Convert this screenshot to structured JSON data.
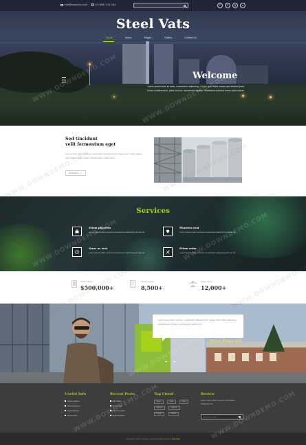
{
  "colors": {
    "accent": "#a8d11c",
    "footer_bg": "#3d3d3d",
    "name_yellow": "#ffe25a"
  },
  "topbar": {
    "email": "info@example.com",
    "phone": "+1 (800) 111 444",
    "search_placeholder": "",
    "social": [
      {
        "icon": "facebook-icon",
        "glyph": "f"
      },
      {
        "icon": "twitter-icon",
        "glyph": "t"
      },
      {
        "icon": "google-plus-icon",
        "glyph": "g"
      },
      {
        "icon": "linkedin-icon",
        "glyph": "in"
      }
    ]
  },
  "header": {
    "logo": "Steel Vats",
    "nav": [
      "Home",
      "About",
      "Pages",
      "Gallery",
      "Contact Us"
    ],
    "active_nav": "Home"
  },
  "hero": {
    "title": "Welcome",
    "text_1": "Lorem ipsum dolor sit amet, consectetur adipiscing. ",
    "highlight": "Integer",
    "text_2": " quis mollis massa quis eleifend justo. Donec condimentum, porta risus et, consectetur laoreet. Vestibulum euismod lectus varius ipsum."
  },
  "about": {
    "title_line1": "Sed tincidunt",
    "title_line2": "velit fermentum eget",
    "text": "Lorem ipsum dolor sit amet, consectetur adipiscing elit. Integer quis mollis massa quis eleifend justo. Donec condimentum mattis risus.",
    "read_more": "Read More"
  },
  "services": {
    "title": "Services",
    "items": [
      {
        "name": "Etiam pharetra",
        "desc": "Lorem ipsum dolor sit amet consectetur adipiscing elit sed do.",
        "icon": "briefcase-icon"
      },
      {
        "name": "Pharetra erat",
        "desc": "Lorem ipsum dolor sit amet consectetur adipiscing elit sed do.",
        "icon": "diamond-icon"
      },
      {
        "name": "Nunc ac erat",
        "desc": "Lorem ipsum dolor sit amet consectetur adipiscing elit sed do.",
        "icon": "clock-icon"
      },
      {
        "name": "Etiam enim",
        "desc": "Lorem ipsum dolor sit amet consectetur adipiscing elit sed do.",
        "icon": "tools-icon"
      }
    ]
  },
  "stats": [
    {
      "label": "Projects Done",
      "value": "$500,000+",
      "icon": "tablet-icon"
    },
    {
      "label": "Working Hours",
      "value": "8,500+",
      "icon": "document-icon"
    },
    {
      "label": "Happy Clients",
      "value": "12,000+",
      "icon": "users-icon"
    }
  ],
  "testimonial": {
    "quote": "Lorem ipsum dolor sit amet, consectetur adipiscing elit. Integer quis mollis massa quis eleifend justo. Donec condimentum mattis risus.",
    "name": "Ultum Primo sed"
  },
  "footer": {
    "useful_info": {
      "title": "Useful Info",
      "links": [
        "Harum quidem",
        "Libero tempore",
        "Quod maxime",
        "Omnis dolor"
      ]
    },
    "recent_posts": {
      "title": "Recent Posts",
      "links": [
        "Nam libero",
        "Ut enim ad",
        "Donec tempus",
        "Nulla tincidunt"
      ]
    },
    "tag_cloud": {
      "title": "Tag Cloud",
      "tags": [
        "Donec",
        "Nulla",
        "Etiam",
        "Maecen",
        "Vivamus",
        "Integer",
        "Nullam"
      ]
    },
    "review": {
      "title": "Review",
      "text": "Lorem ipsum dolor sit amet, consectetur adipiscing elit.",
      "placeholder": "Enter your email..."
    }
  },
  "copyright": {
    "text": "Copyright © 2017 Company name All rights reserved. ",
    "link": "ACE Web"
  },
  "watermark": "WWW.DOWNDEMO.COM"
}
